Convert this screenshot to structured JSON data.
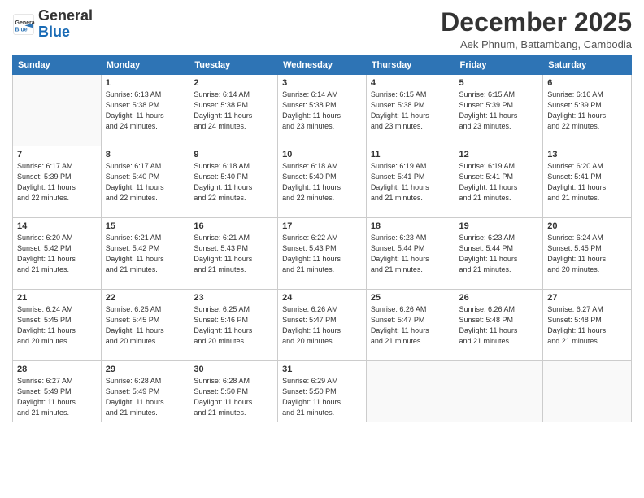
{
  "logo": {
    "general": "General",
    "blue": "Blue"
  },
  "header": {
    "month_title": "December 2025",
    "location": "Aek Phnum, Battambang, Cambodia"
  },
  "days_of_week": [
    "Sunday",
    "Monday",
    "Tuesday",
    "Wednesday",
    "Thursday",
    "Friday",
    "Saturday"
  ],
  "weeks": [
    [
      {
        "day": "",
        "info": ""
      },
      {
        "day": "1",
        "info": "Sunrise: 6:13 AM\nSunset: 5:38 PM\nDaylight: 11 hours\nand 24 minutes."
      },
      {
        "day": "2",
        "info": "Sunrise: 6:14 AM\nSunset: 5:38 PM\nDaylight: 11 hours\nand 24 minutes."
      },
      {
        "day": "3",
        "info": "Sunrise: 6:14 AM\nSunset: 5:38 PM\nDaylight: 11 hours\nand 23 minutes."
      },
      {
        "day": "4",
        "info": "Sunrise: 6:15 AM\nSunset: 5:38 PM\nDaylight: 11 hours\nand 23 minutes."
      },
      {
        "day": "5",
        "info": "Sunrise: 6:15 AM\nSunset: 5:39 PM\nDaylight: 11 hours\nand 23 minutes."
      },
      {
        "day": "6",
        "info": "Sunrise: 6:16 AM\nSunset: 5:39 PM\nDaylight: 11 hours\nand 22 minutes."
      }
    ],
    [
      {
        "day": "7",
        "info": "Sunrise: 6:17 AM\nSunset: 5:39 PM\nDaylight: 11 hours\nand 22 minutes."
      },
      {
        "day": "8",
        "info": "Sunrise: 6:17 AM\nSunset: 5:40 PM\nDaylight: 11 hours\nand 22 minutes."
      },
      {
        "day": "9",
        "info": "Sunrise: 6:18 AM\nSunset: 5:40 PM\nDaylight: 11 hours\nand 22 minutes."
      },
      {
        "day": "10",
        "info": "Sunrise: 6:18 AM\nSunset: 5:40 PM\nDaylight: 11 hours\nand 22 minutes."
      },
      {
        "day": "11",
        "info": "Sunrise: 6:19 AM\nSunset: 5:41 PM\nDaylight: 11 hours\nand 21 minutes."
      },
      {
        "day": "12",
        "info": "Sunrise: 6:19 AM\nSunset: 5:41 PM\nDaylight: 11 hours\nand 21 minutes."
      },
      {
        "day": "13",
        "info": "Sunrise: 6:20 AM\nSunset: 5:41 PM\nDaylight: 11 hours\nand 21 minutes."
      }
    ],
    [
      {
        "day": "14",
        "info": "Sunrise: 6:20 AM\nSunset: 5:42 PM\nDaylight: 11 hours\nand 21 minutes."
      },
      {
        "day": "15",
        "info": "Sunrise: 6:21 AM\nSunset: 5:42 PM\nDaylight: 11 hours\nand 21 minutes."
      },
      {
        "day": "16",
        "info": "Sunrise: 6:21 AM\nSunset: 5:43 PM\nDaylight: 11 hours\nand 21 minutes."
      },
      {
        "day": "17",
        "info": "Sunrise: 6:22 AM\nSunset: 5:43 PM\nDaylight: 11 hours\nand 21 minutes."
      },
      {
        "day": "18",
        "info": "Sunrise: 6:23 AM\nSunset: 5:44 PM\nDaylight: 11 hours\nand 21 minutes."
      },
      {
        "day": "19",
        "info": "Sunrise: 6:23 AM\nSunset: 5:44 PM\nDaylight: 11 hours\nand 21 minutes."
      },
      {
        "day": "20",
        "info": "Sunrise: 6:24 AM\nSunset: 5:45 PM\nDaylight: 11 hours\nand 20 minutes."
      }
    ],
    [
      {
        "day": "21",
        "info": "Sunrise: 6:24 AM\nSunset: 5:45 PM\nDaylight: 11 hours\nand 20 minutes."
      },
      {
        "day": "22",
        "info": "Sunrise: 6:25 AM\nSunset: 5:45 PM\nDaylight: 11 hours\nand 20 minutes."
      },
      {
        "day": "23",
        "info": "Sunrise: 6:25 AM\nSunset: 5:46 PM\nDaylight: 11 hours\nand 20 minutes."
      },
      {
        "day": "24",
        "info": "Sunrise: 6:26 AM\nSunset: 5:47 PM\nDaylight: 11 hours\nand 20 minutes."
      },
      {
        "day": "25",
        "info": "Sunrise: 6:26 AM\nSunset: 5:47 PM\nDaylight: 11 hours\nand 21 minutes."
      },
      {
        "day": "26",
        "info": "Sunrise: 6:26 AM\nSunset: 5:48 PM\nDaylight: 11 hours\nand 21 minutes."
      },
      {
        "day": "27",
        "info": "Sunrise: 6:27 AM\nSunset: 5:48 PM\nDaylight: 11 hours\nand 21 minutes."
      }
    ],
    [
      {
        "day": "28",
        "info": "Sunrise: 6:27 AM\nSunset: 5:49 PM\nDaylight: 11 hours\nand 21 minutes."
      },
      {
        "day": "29",
        "info": "Sunrise: 6:28 AM\nSunset: 5:49 PM\nDaylight: 11 hours\nand 21 minutes."
      },
      {
        "day": "30",
        "info": "Sunrise: 6:28 AM\nSunset: 5:50 PM\nDaylight: 11 hours\nand 21 minutes."
      },
      {
        "day": "31",
        "info": "Sunrise: 6:29 AM\nSunset: 5:50 PM\nDaylight: 11 hours\nand 21 minutes."
      },
      {
        "day": "",
        "info": ""
      },
      {
        "day": "",
        "info": ""
      },
      {
        "day": "",
        "info": ""
      }
    ]
  ]
}
